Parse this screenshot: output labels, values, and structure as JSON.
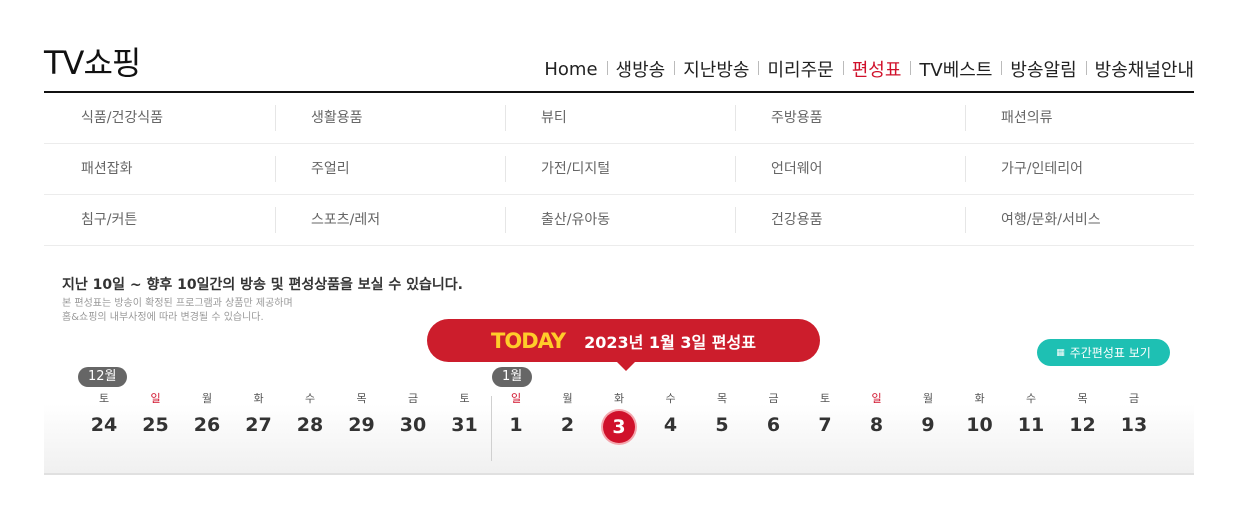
{
  "logo": "TV쇼핑",
  "nav": [
    "Home",
    "생방송",
    "지난방송",
    "미리주문",
    "편성표",
    "TV베스트",
    "방송알림",
    "방송채널안내"
  ],
  "active_nav": "편성표",
  "categories": [
    [
      "식품/건강식품",
      "생활용품",
      "뷰티",
      "주방용품",
      "패션의류"
    ],
    [
      "패션잡화",
      "주얼리",
      "가전/디지털",
      "언더웨어",
      "가구/인테리어"
    ],
    [
      "침구/커튼",
      "스포츠/레저",
      "출산/유아동",
      "건강용품",
      "여행/문화/서비스"
    ]
  ],
  "info": {
    "title": "지난 10일 ~ 향후 10일간의 방송 및 편성상품을 보실 수 있습니다.",
    "line1": "본 편성표는 방송이 확정된 프로그램과 상품만 제공하며",
    "line2": "홈&쇼핑의 내부사정에 따라 변경될 수 있습니다."
  },
  "today_banner": {
    "tag": "TODAY",
    "date": "2023년 1월 3일 편성표"
  },
  "weekly_button": "주간편성표 보기",
  "months": [
    "12월",
    "1월"
  ],
  "days": [
    {
      "wd": "토",
      "d": "24"
    },
    {
      "wd": "일",
      "d": "25",
      "sun": true
    },
    {
      "wd": "월",
      "d": "26"
    },
    {
      "wd": "화",
      "d": "27"
    },
    {
      "wd": "수",
      "d": "28"
    },
    {
      "wd": "목",
      "d": "29"
    },
    {
      "wd": "금",
      "d": "30"
    },
    {
      "wd": "토",
      "d": "31"
    },
    {
      "wd": "일",
      "d": "1",
      "sun": true
    },
    {
      "wd": "월",
      "d": "2"
    },
    {
      "wd": "화",
      "d": "3",
      "today": true
    },
    {
      "wd": "수",
      "d": "4"
    },
    {
      "wd": "목",
      "d": "5"
    },
    {
      "wd": "금",
      "d": "6"
    },
    {
      "wd": "토",
      "d": "7"
    },
    {
      "wd": "일",
      "d": "8",
      "sun": true
    },
    {
      "wd": "월",
      "d": "9"
    },
    {
      "wd": "화",
      "d": "10"
    },
    {
      "wd": "수",
      "d": "11"
    },
    {
      "wd": "목",
      "d": "12"
    },
    {
      "wd": "금",
      "d": "13"
    }
  ],
  "colors": {
    "accent": "#d0112b",
    "today_tag": "#ffcc2a",
    "weekly": "#1ec0b3"
  }
}
